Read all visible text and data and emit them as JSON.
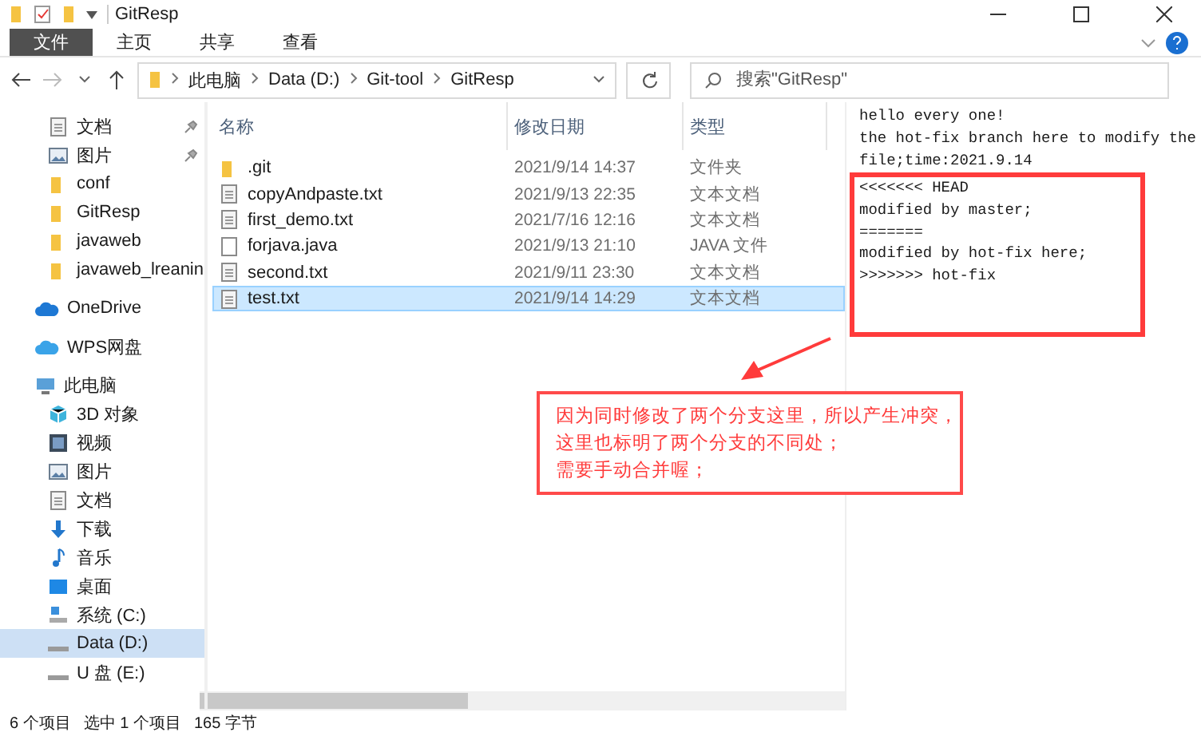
{
  "window": {
    "title": "GitResp"
  },
  "ribbon_tabs": [
    {
      "label": "文件",
      "selected": true
    },
    {
      "label": "主页",
      "selected": false
    },
    {
      "label": "共享",
      "selected": false
    },
    {
      "label": "查看",
      "selected": false
    }
  ],
  "address_bar": {
    "path": [
      "此电脑",
      "Data (D:)",
      "Git-tool",
      "GitResp"
    ]
  },
  "search": {
    "placeholder": "搜索\"GitResp\""
  },
  "sidebar": {
    "sections": [
      {
        "items": [
          {
            "label": "文档",
            "kind": "doc",
            "pinned": true,
            "selected": false
          },
          {
            "label": "图片",
            "kind": "image",
            "pinned": true,
            "selected": false
          },
          {
            "label": "conf",
            "kind": "folder",
            "pinned": false,
            "selected": false
          },
          {
            "label": "GitResp",
            "kind": "folder",
            "pinned": false,
            "selected": false
          },
          {
            "label": "javaweb",
            "kind": "folder",
            "pinned": false,
            "selected": false
          },
          {
            "label": "javaweb_lreanin",
            "kind": "folder",
            "pinned": false,
            "selected": false
          }
        ]
      },
      {
        "items": [
          {
            "label": "OneDrive",
            "kind": "cloud",
            "pinned": false,
            "selected": false
          }
        ]
      },
      {
        "items": [
          {
            "label": "WPS网盘",
            "kind": "cloud2",
            "pinned": false,
            "selected": false
          }
        ]
      },
      {
        "items": [
          {
            "label": "此电脑",
            "kind": "pc",
            "pinned": false,
            "selected": false,
            "children": [
              {
                "label": "3D 对象",
                "kind": "cube",
                "pinned": false,
                "selected": false
              },
              {
                "label": "视频",
                "kind": "video",
                "pinned": false,
                "selected": false
              },
              {
                "label": "图片",
                "kind": "image",
                "pinned": false,
                "selected": false
              },
              {
                "label": "文档",
                "kind": "doc",
                "pinned": false,
                "selected": false
              },
              {
                "label": "下载",
                "kind": "download",
                "pinned": false,
                "selected": false
              },
              {
                "label": "音乐",
                "kind": "music",
                "pinned": false,
                "selected": false
              },
              {
                "label": "桌面",
                "kind": "desktop",
                "pinned": false,
                "selected": false
              },
              {
                "label": "系统 (C:)",
                "kind": "sysdrive",
                "pinned": false,
                "selected": false
              },
              {
                "label": "Data (D:)",
                "kind": "drive",
                "pinned": false,
                "selected": true
              },
              {
                "label": "U 盘 (E:)",
                "kind": "drive",
                "pinned": false,
                "selected": false
              }
            ]
          }
        ]
      }
    ]
  },
  "columns": [
    "名称",
    "修改日期",
    "类型"
  ],
  "rows": [
    {
      "name": ".git",
      "kind": "folder",
      "modified": "2021/9/14 14:37",
      "type": "文件夹",
      "selected": false
    },
    {
      "name": "copyAndpaste.txt",
      "kind": "text",
      "modified": "2021/9/13 22:35",
      "type": "文本文档",
      "selected": false
    },
    {
      "name": "first_demo.txt",
      "kind": "text",
      "modified": "2021/7/16 12:16",
      "type": "文本文档",
      "selected": false
    },
    {
      "name": "forjava.java",
      "kind": "file",
      "modified": "2021/9/13 21:10",
      "type": "JAVA 文件",
      "selected": false
    },
    {
      "name": "second.txt",
      "kind": "text",
      "modified": "2021/9/11 23:30",
      "type": "文本文档",
      "selected": false
    },
    {
      "name": "test.txt",
      "kind": "text",
      "modified": "2021/9/14 14:29",
      "type": "文本文档",
      "selected": true
    }
  ],
  "preview": {
    "lines": [
      "hello every one!",
      "the hot-fix branch here to modify the",
      "file;time:2021.9.14"
    ],
    "highlighted_lines": [
      "<<<<<<< HEAD",
      "modified by master;",
      "=======",
      "modified by hot-fix here;",
      ">>>>>>> hot-fix"
    ]
  },
  "annotation": {
    "lines": [
      "因为同时修改了两个分支这里，所以产生冲突，",
      "这里也标明了两个分支的不同处；",
      "需要手动合并喔；"
    ]
  },
  "status_bar": {
    "count": "6 个项目",
    "selection": "选中 1 个项目",
    "size": "165 字节"
  }
}
